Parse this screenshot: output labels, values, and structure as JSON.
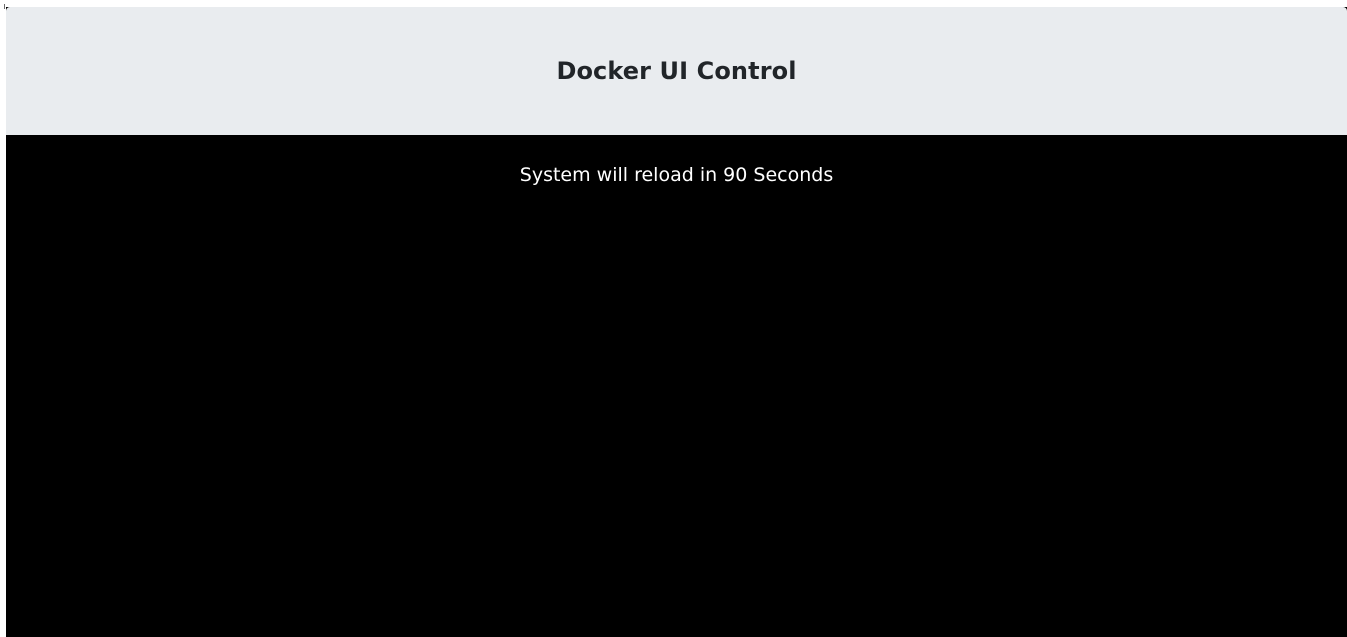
{
  "header": {
    "title": "Docker UI Control"
  },
  "main": {
    "reload_message": "System will reload in 90 Seconds"
  },
  "colors": {
    "header_bg": "#e9ecef",
    "header_text": "#212529",
    "content_bg": "#000000",
    "content_text": "#ffffff"
  }
}
